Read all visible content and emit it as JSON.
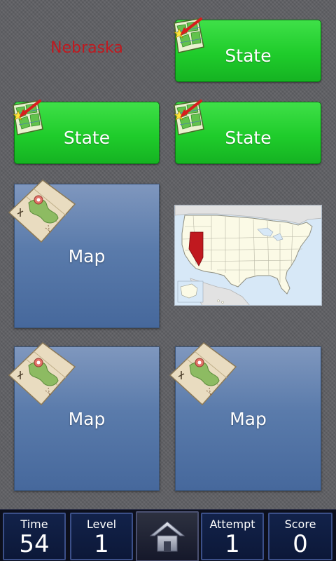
{
  "prompt": {
    "state_name": "Nebraska",
    "color": "#c0191f"
  },
  "cards": [
    {
      "type": "state",
      "label": "State",
      "icon": "state-map-arrow-icon",
      "face": "down"
    },
    {
      "type": "state",
      "label": "State",
      "icon": "state-map-arrow-icon",
      "face": "down"
    },
    {
      "type": "state",
      "label": "State",
      "icon": "state-map-arrow-icon",
      "face": "down"
    },
    {
      "type": "map",
      "label": "Map",
      "icon": "folded-map-icon",
      "face": "down"
    },
    {
      "type": "map",
      "label": "",
      "icon": "us-map-nevada-highlighted",
      "face": "up"
    },
    {
      "type": "map",
      "label": "Map",
      "icon": "folded-map-icon",
      "face": "down"
    },
    {
      "type": "map",
      "label": "Map",
      "icon": "folded-map-icon",
      "face": "down"
    }
  ],
  "stats": {
    "time": {
      "label": "Time",
      "value": "54"
    },
    "level": {
      "label": "Level",
      "value": "1"
    },
    "attempt": {
      "label": "Attempt",
      "value": "1"
    },
    "score": {
      "label": "Score",
      "value": "0"
    }
  },
  "home": {
    "icon": "home-icon"
  },
  "colors": {
    "state_green": "#22cc2e",
    "map_blue": "#5a7bab",
    "highlight_state": "#c0191f",
    "background": "#5e5f63"
  }
}
